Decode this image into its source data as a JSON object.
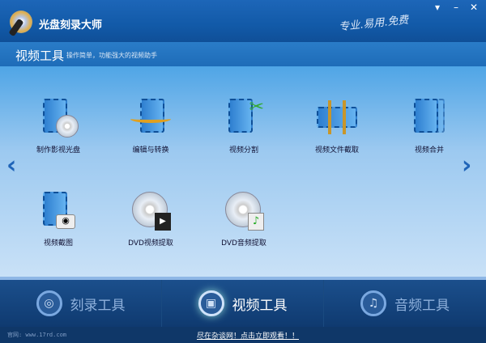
{
  "app": {
    "title": "光盘刻录大师",
    "slogan": "专业.易用.免费"
  },
  "window": {
    "menu": "▾",
    "minimize": "–",
    "close": "✕"
  },
  "header": {
    "title": "视频工具",
    "description": "操作简单，功能强大的视频助手"
  },
  "tools": [
    {
      "label": "制作影视光盘"
    },
    {
      "label": "编辑与转换"
    },
    {
      "label": "视频分割"
    },
    {
      "label": "视频文件截取"
    },
    {
      "label": "视频合并"
    },
    {
      "label": "视频截图"
    },
    {
      "label": "DVD视频提取"
    },
    {
      "label": "DVD音频提取"
    }
  ],
  "nav": [
    {
      "label": "刻录工具"
    },
    {
      "label": "视频工具"
    },
    {
      "label": "音频工具"
    }
  ],
  "footer": {
    "site": "官网: www.17rd.com",
    "promo": "尽在杂谈网！点击立即观看！！"
  }
}
